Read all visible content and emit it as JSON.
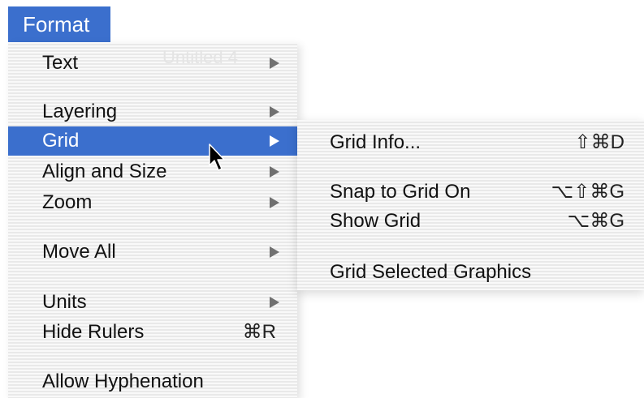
{
  "menu_bar": {
    "title": "Format"
  },
  "format_menu": {
    "background_window_title": "Untitled 4",
    "items": [
      {
        "label": "Text",
        "has_submenu": true
      },
      {
        "label": "Layering",
        "has_submenu": true
      },
      {
        "label": "Grid",
        "has_submenu": true,
        "selected": true
      },
      {
        "label": "Align and Size",
        "has_submenu": true
      },
      {
        "label": "Zoom",
        "has_submenu": true
      },
      {
        "label": "Move All",
        "has_submenu": true
      },
      {
        "label": "Units",
        "has_submenu": true
      },
      {
        "label": "Hide Rulers",
        "shortcut": "⌘R"
      },
      {
        "label": "Allow Hyphenation"
      }
    ]
  },
  "grid_submenu": {
    "items": [
      {
        "label": "Grid Info...",
        "shortcut": "⇧⌘D"
      },
      {
        "label": "Snap to Grid On",
        "shortcut": "⌥⇧⌘G"
      },
      {
        "label": "Show Grid",
        "shortcut": "⌥⌘G"
      },
      {
        "label": "Grid Selected Graphics"
      }
    ]
  },
  "icons": {
    "submenu_indicator": "submenu-arrow-icon",
    "pointer": "mouse-cursor-icon"
  },
  "colors": {
    "selection": "#3b6fcd",
    "text": "#111111",
    "selected_text": "#ffffff",
    "arrow": "#707070"
  }
}
